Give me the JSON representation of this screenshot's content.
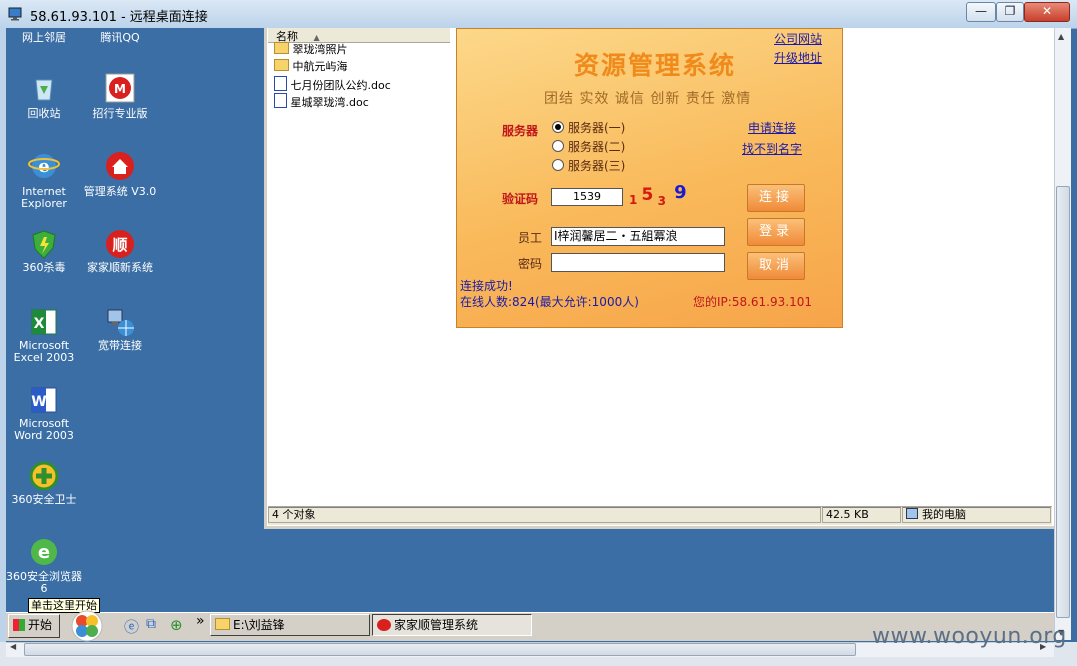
{
  "rdp": {
    "title": "58.61.93.101 - 远程桌面连接",
    "minimize": "—",
    "restore": "❐",
    "close": "✕"
  },
  "desktop": {
    "icons": [
      {
        "label": "网上邻居"
      },
      {
        "label": "腾讯QQ"
      },
      {
        "label": "回收站"
      },
      {
        "label": "招行专业版"
      },
      {
        "label": "Internet Explorer"
      },
      {
        "label": "管理系统 V3.0"
      },
      {
        "label": "360杀毒"
      },
      {
        "label": "家家顺新系统"
      },
      {
        "label": "Microsoft Excel 2003"
      },
      {
        "label": "宽带连接"
      },
      {
        "label": "Microsoft Word 2003"
      },
      {
        "label": "360安全卫士"
      },
      {
        "label": "360安全浏览器6"
      }
    ]
  },
  "explorer": {
    "column_name": "名称",
    "files": [
      {
        "name": "翠珑湾照片",
        "type": "folder"
      },
      {
        "name": "中航元屿海",
        "type": "folder"
      },
      {
        "name": "七月份团队公约.doc",
        "type": "doc"
      },
      {
        "name": "星城翠珑湾.doc",
        "type": "doc"
      }
    ],
    "status_count": "4 个对象",
    "status_size": "42.5 KB",
    "status_location": "我的电脑"
  },
  "app": {
    "title": "资源管理系统",
    "motto": "团结 实效 诚信 创新 责任 激情",
    "link_company": "公司网站",
    "link_upgrade": "升级地址",
    "link_apply": "申请连接",
    "link_no_name": "找不到名字",
    "server_label": "服务器",
    "servers": [
      "服务器(一)",
      "服务器(二)",
      "服务器(三)"
    ],
    "selected_server": 0,
    "captcha_label": "验证码",
    "captcha_value": "1539",
    "captcha_chars": [
      {
        "ch": "1",
        "color": "#d21a10"
      },
      {
        "ch": "5",
        "color": "#d21a10"
      },
      {
        "ch": "3",
        "color": "#d21a10"
      },
      {
        "ch": "9",
        "color": "#1a1ad0"
      }
    ],
    "employee_label": "员工",
    "employee_value": "I梓润馨居二・五組冪浪",
    "password_label": "密码",
    "password_value": "",
    "btn_connect": "连接",
    "btn_login": "登录",
    "btn_cancel": "取消",
    "status_connected": "连接成功!",
    "online_text": "在线人数:824(最大允许:1000人)",
    "ip_text": "您的IP:58.61.93.101",
    "colors": {
      "link": "#1a1aaa",
      "red": "#c0161a",
      "online": "#1a1aaa",
      "connected": "#1a1aaa"
    }
  },
  "taskbar": {
    "start": "开始",
    "tooltip": "单击这里开始",
    "more": "»",
    "task1": "E:\\刘益锋",
    "task2": "家家顺管理系统"
  },
  "watermark": "www.wooyun.org"
}
